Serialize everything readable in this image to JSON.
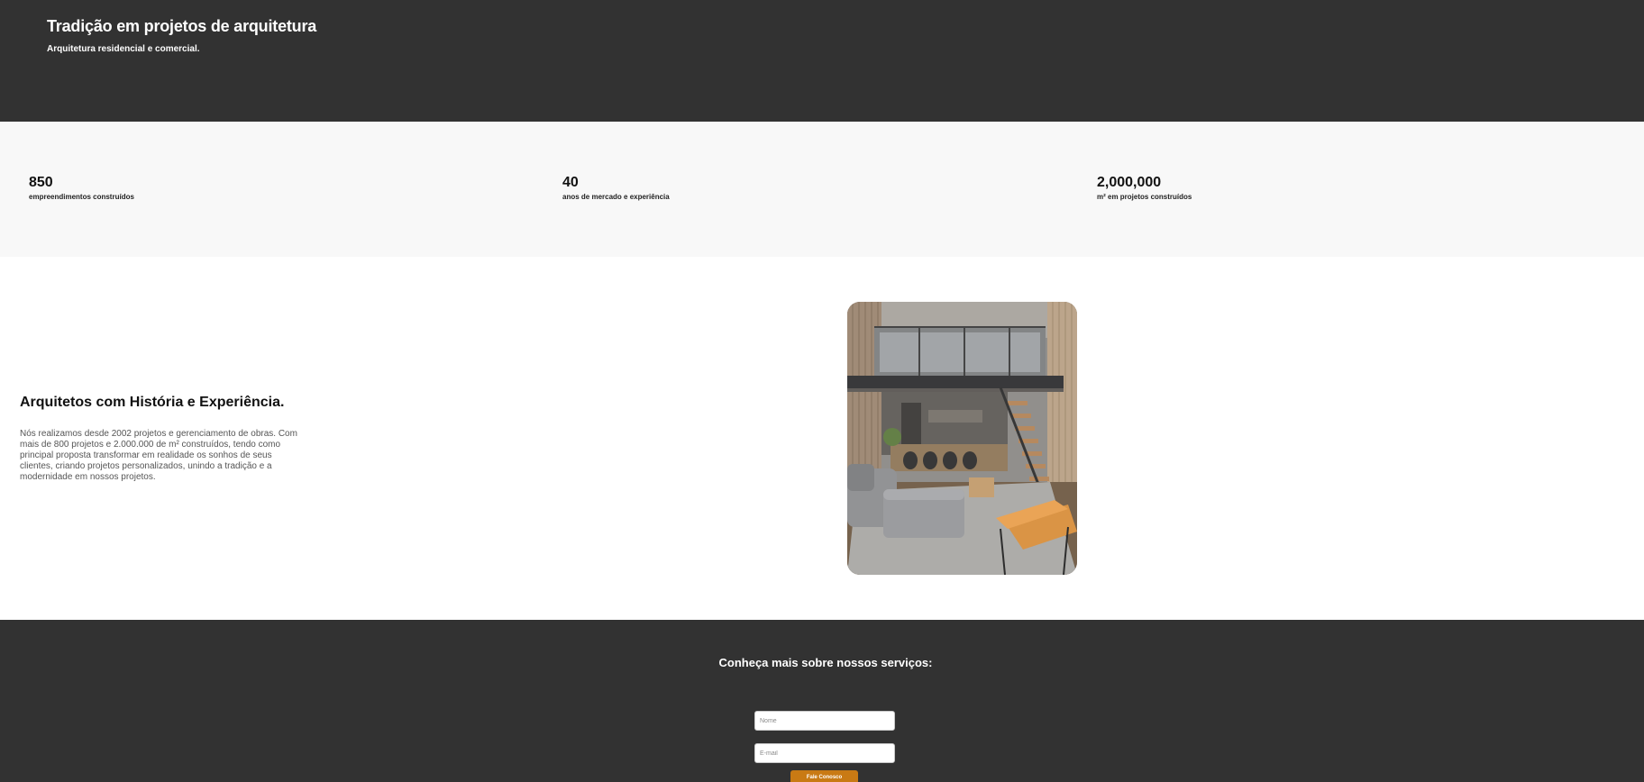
{
  "hero": {
    "title": "Tradição em projetos de arquitetura",
    "subtitle": "Arquitetura residencial e comercial."
  },
  "stats": [
    {
      "value": "850",
      "label": "empreendimentos construídos"
    },
    {
      "value": "40",
      "label": "anos de mercado e experiência"
    },
    {
      "value": "2,000,000",
      "label": "m² em projetos construídos"
    }
  ],
  "about": {
    "heading": "Arquitetos com História e Experiência.",
    "text": "Nós realizamos desde 2002 projetos e gerenciamento de obras. Com mais de 800 projetos e 2.000.000 de m² construídos, tendo como principal proposta transformar em realidade os sonhos de seus clientes, criando projetos personalizados, unindo a tradição e a modernidade em nossos projetos.",
    "photo_icon": "loft-interior-photo"
  },
  "contact": {
    "heading": "Conheça mais sobre nossos serviços:",
    "name_placeholder": "Nome",
    "email_placeholder": "E-mail",
    "submit_label": "Fale Conosco"
  },
  "colors": {
    "dark_background": "#323232",
    "light_background": "#f8f8f8",
    "accent": "#c97a14"
  }
}
